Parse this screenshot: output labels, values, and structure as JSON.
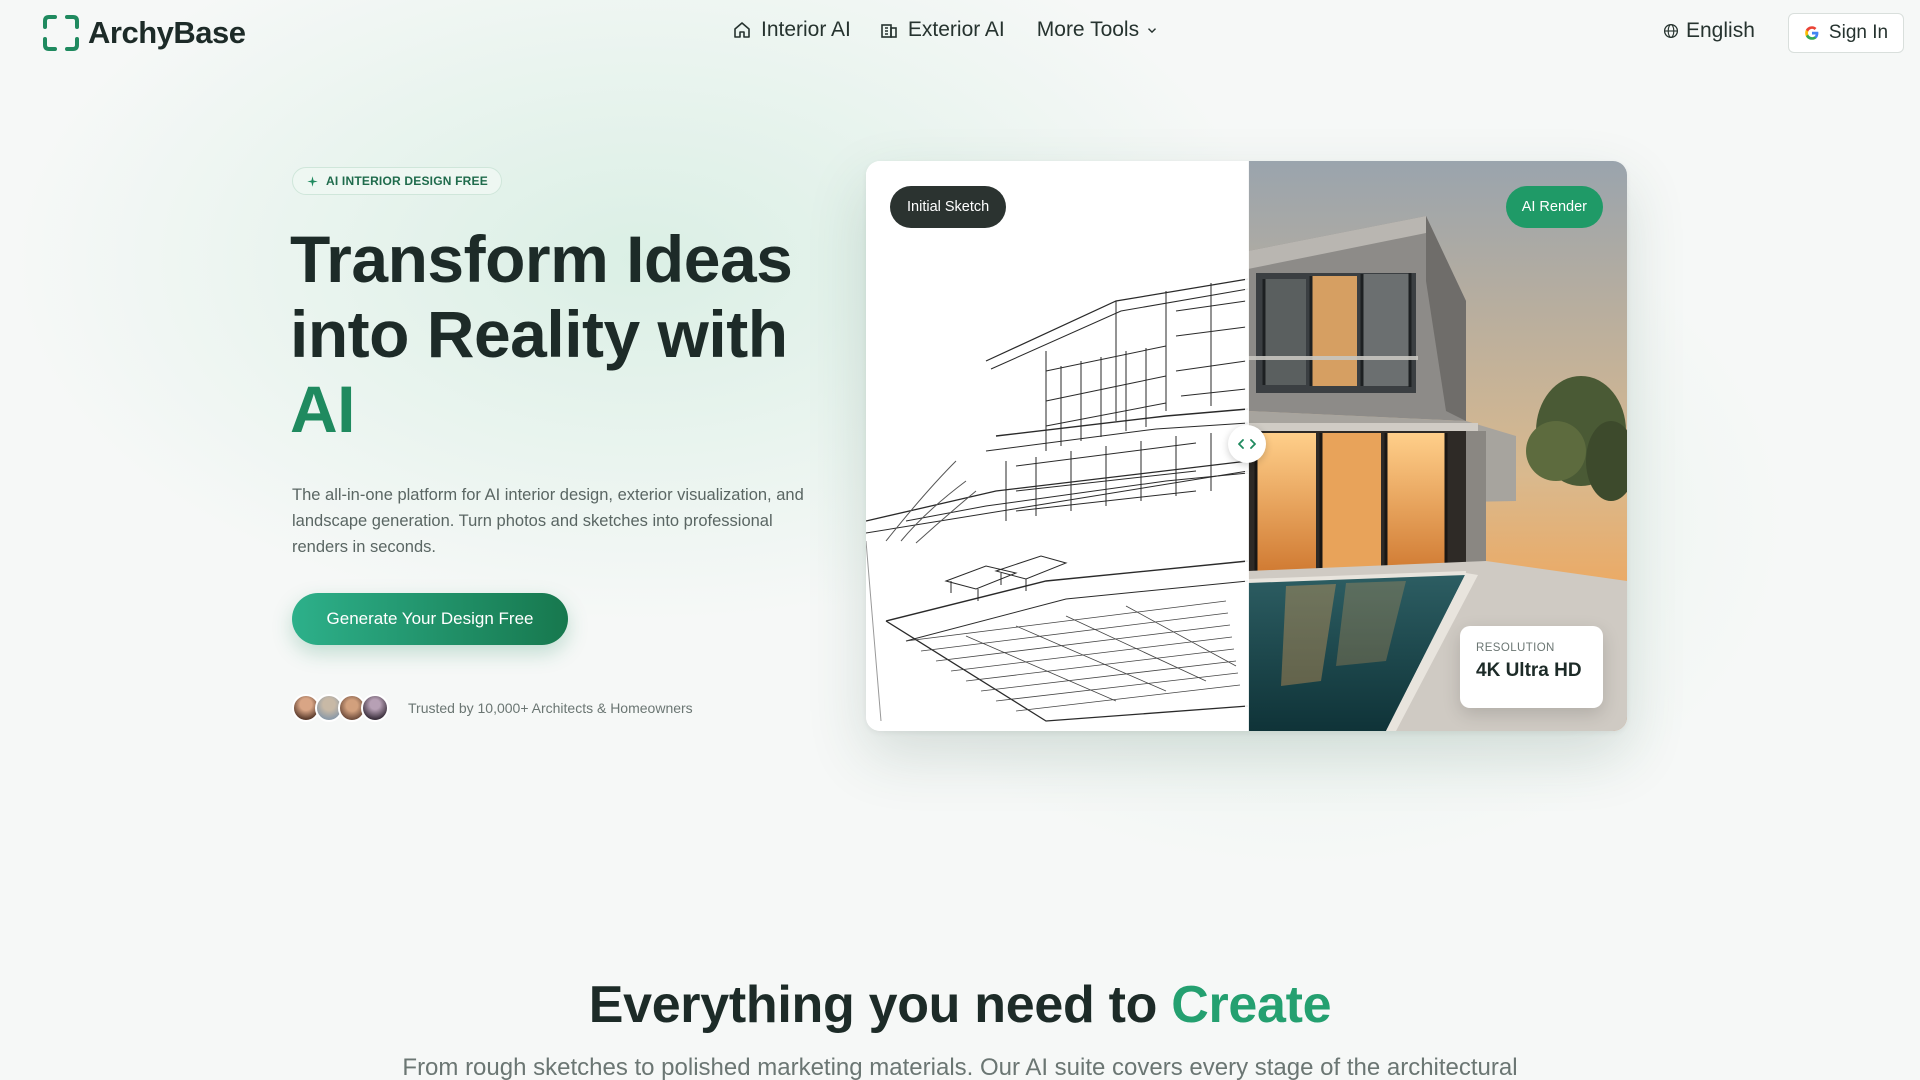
{
  "brand": {
    "name": "ArchyBase",
    "accent": "#1f8a5f"
  },
  "nav": {
    "items": [
      {
        "label": "Interior AI",
        "icon": "home-icon"
      },
      {
        "label": "Exterior AI",
        "icon": "building-icon"
      },
      {
        "label": "More Tools",
        "icon": "chevron-down-icon"
      }
    ],
    "language": "English",
    "sign_in": "Sign In"
  },
  "hero": {
    "pill": "AI INTERIOR DESIGN FREE",
    "title_lines": [
      "Transform Ideas",
      "into Reality with"
    ],
    "title_accent": "AI",
    "description": "The all-in-one platform for AI interior design, exterior visualization, and landscape generation. Turn photos and sketches into professional renders in seconds.",
    "cta": "Generate Your Design Free",
    "trust_text": "Trusted by 10,000+ Architects & Homeowners"
  },
  "comparison": {
    "left_badge": "Initial Sketch",
    "right_badge": "AI Render",
    "resolution_label": "RESOLUTION",
    "resolution_value": "4K Ultra HD"
  },
  "section": {
    "title_main": "Everything you need to ",
    "title_accent": "Create",
    "subtitle": "From rough sketches to polished marketing materials. Our AI suite covers every stage of the architectural"
  }
}
